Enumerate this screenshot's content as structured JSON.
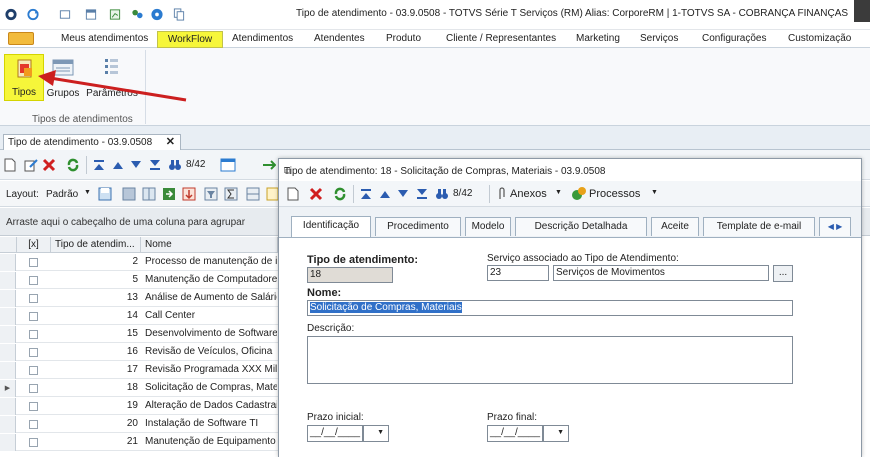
{
  "window": {
    "title": "Tipo de atendimento - 03.9.0508 - TOTVS Série T Serviços (RM) Alias: CorporeRM | 1-TOTVS SA - COBRANÇA FINANÇAS"
  },
  "ribbon_tabs": [
    "Meus atendimentos",
    "WorkFlow",
    "Atendimentos",
    "Atendentes",
    "Produto",
    "Cliente / Representantes",
    "Marketing",
    "Serviços",
    "Configurações",
    "Customização"
  ],
  "ribbon": {
    "buttons": {
      "tipos": "Tipos",
      "grupos": "Grupos",
      "parametros": "Parâmetros"
    },
    "group_label": "Tipos de atendimentos"
  },
  "document_tab": {
    "label": "Tipo de atendimento - 03.9.0508"
  },
  "toolbar": {
    "record_counter": "8/42"
  },
  "layout_bar": {
    "layout_label": "Layout:",
    "layout_value": "Padrão"
  },
  "group_panel": {
    "hint": "Arraste aqui o cabeçalho de uma coluna para agrupar"
  },
  "grid": {
    "columns": [
      "[x]",
      "Tipo de atendim...",
      "Nome"
    ],
    "rows": [
      {
        "id": "2",
        "name": "Processo de manutenção de im"
      },
      {
        "id": "5",
        "name": "Manutenção de Computadores"
      },
      {
        "id": "13",
        "name": "Análise de Aumento de Salário"
      },
      {
        "id": "14",
        "name": "Call Center"
      },
      {
        "id": "15",
        "name": "Desenvolvimento  de Software"
      },
      {
        "id": "16",
        "name": "Revisão de Veículos, Oficina"
      },
      {
        "id": "17",
        "name": "Revisão Programada XXX Mil Kı"
      },
      {
        "id": "18",
        "name": "Solicitação de Compras, Materi"
      },
      {
        "id": "19",
        "name": "Alteração de Dados Cadastrais"
      },
      {
        "id": "20",
        "name": "Instalação de Software TI"
      },
      {
        "id": "21",
        "name": "Manutenção de Equipamento T"
      }
    ]
  },
  "dialog": {
    "title": "Tipo de atendimento: 18 - Solicitação de Compras, Materiais - 03.9.0508",
    "toolbar": {
      "counter": "8/42",
      "anexos": "Anexos",
      "processos": "Processos"
    },
    "tabs": [
      "Identificação",
      "Procedimento",
      "Modelo",
      "Descrição Detalhada",
      "Aceite",
      "Template de e-mail"
    ],
    "form": {
      "tipo_label": "Tipo de atendimento:",
      "tipo_value": "18",
      "servico_label": "Serviço associado ao Tipo de Atendimento:",
      "servico_code": "23",
      "servico_name": "Serviços de Movimentos",
      "nome_label": "Nome:",
      "nome_value": "Solicitação de Compras, Materiais",
      "descricao_label": "Descrição:",
      "descricao_value": "",
      "prazo_inicial_label": "Prazo inicial:",
      "prazo_inicial_value": "__/__/____",
      "prazo_final_label": "Prazo final:",
      "prazo_final_value": "__/__/____"
    }
  },
  "colors": {
    "highlight": "#f6f63a",
    "arrow": "#cc1f1f",
    "selection": "#3070c8"
  }
}
